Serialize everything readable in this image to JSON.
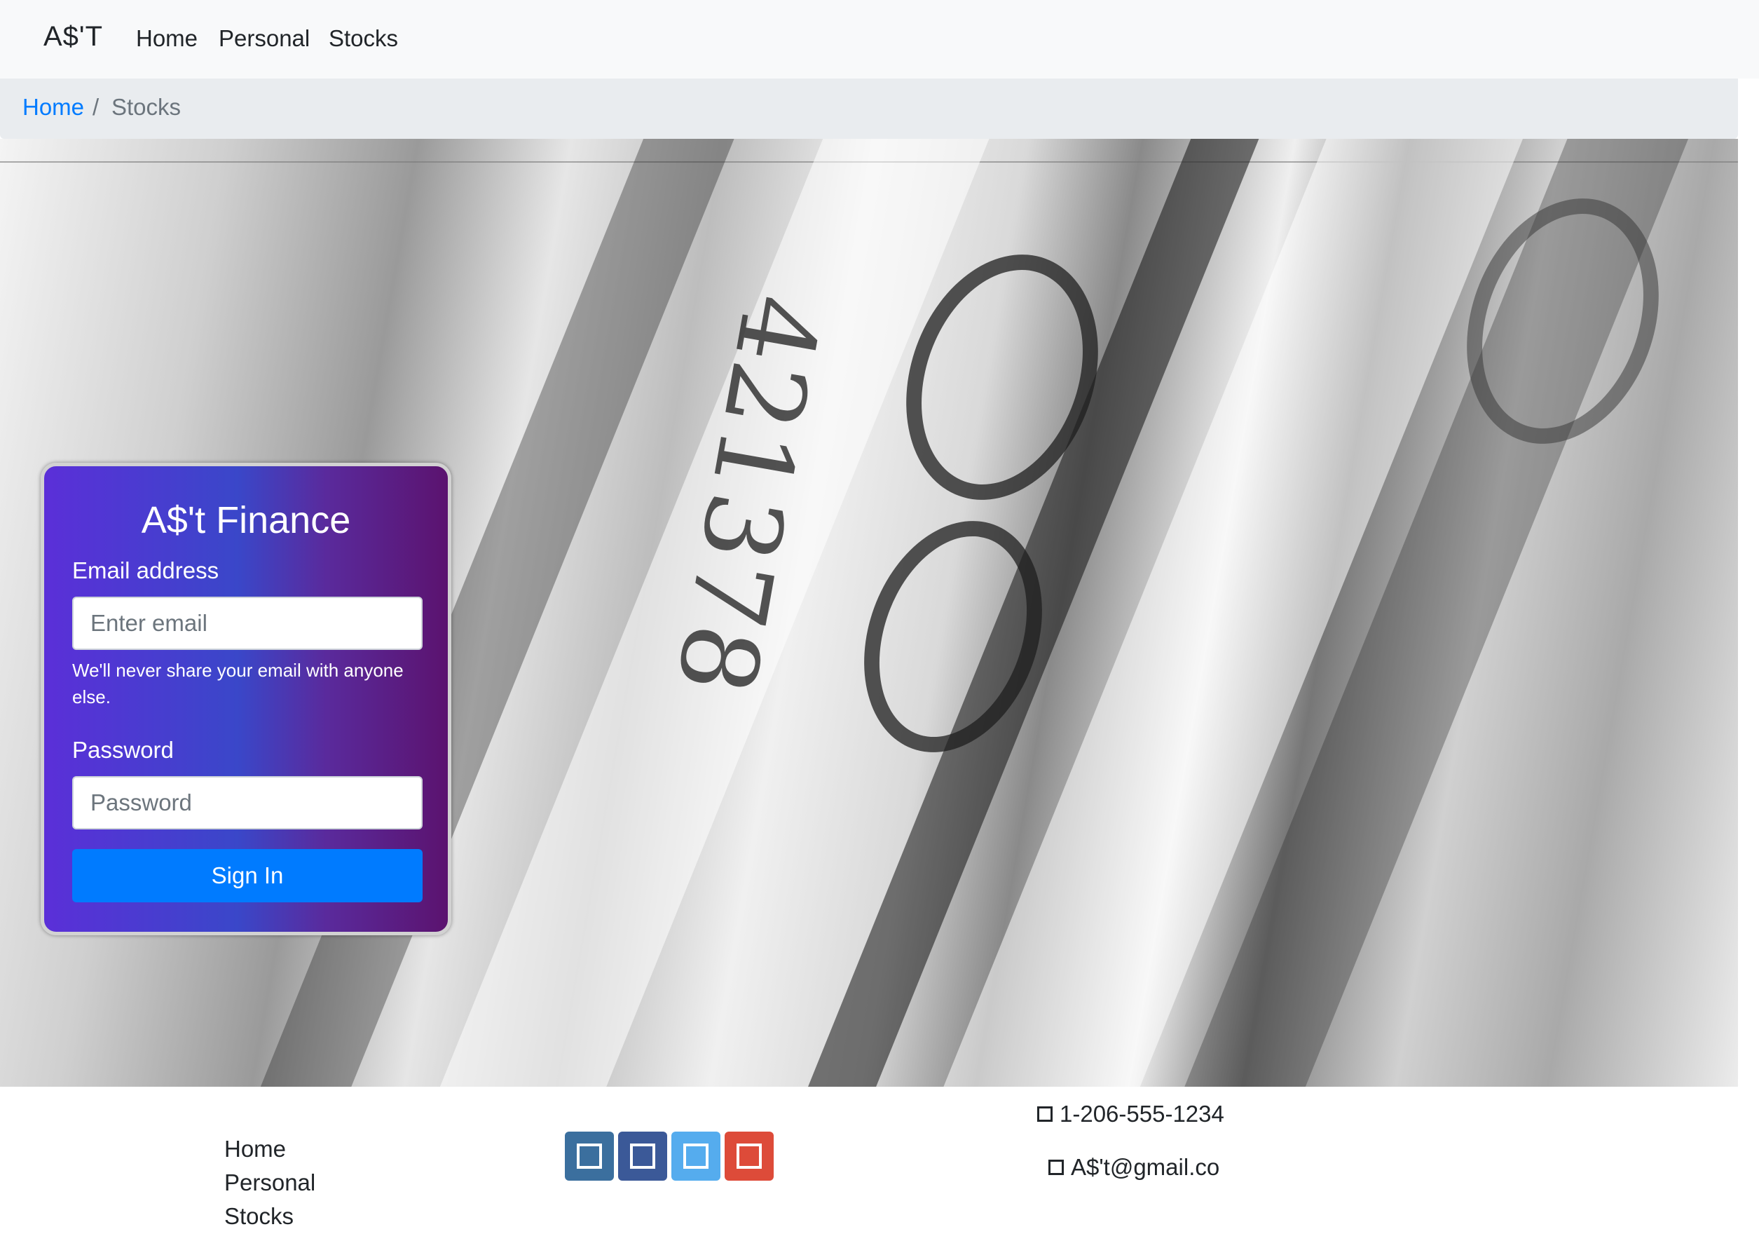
{
  "navbar": {
    "brand": "A$'T",
    "links": [
      "Home",
      "Personal",
      "Stocks"
    ]
  },
  "breadcrumb": {
    "home": "Home",
    "separator": "/",
    "current": "Stocks"
  },
  "login": {
    "title": "A$'t Finance",
    "email_label": "Email address",
    "email_placeholder": "Enter email",
    "email_help": "We'll never share your email with anyone else.",
    "password_label": "Password",
    "password_placeholder": "Password",
    "submit_label": "Sign In"
  },
  "hero": {
    "numerals": "421378"
  },
  "footer": {
    "links": [
      "Home",
      "Personal",
      "Stocks"
    ],
    "social": [
      {
        "icon": "linkedin-icon",
        "color": "#3b6f9e"
      },
      {
        "icon": "facebook-icon",
        "color": "#3b5998"
      },
      {
        "icon": "twitter-icon",
        "color": "#55acee"
      },
      {
        "icon": "google-plus-icon",
        "color": "#dd4b39"
      }
    ],
    "phone": "1-206-555-1234",
    "email": "A$'t@gmail.co"
  }
}
